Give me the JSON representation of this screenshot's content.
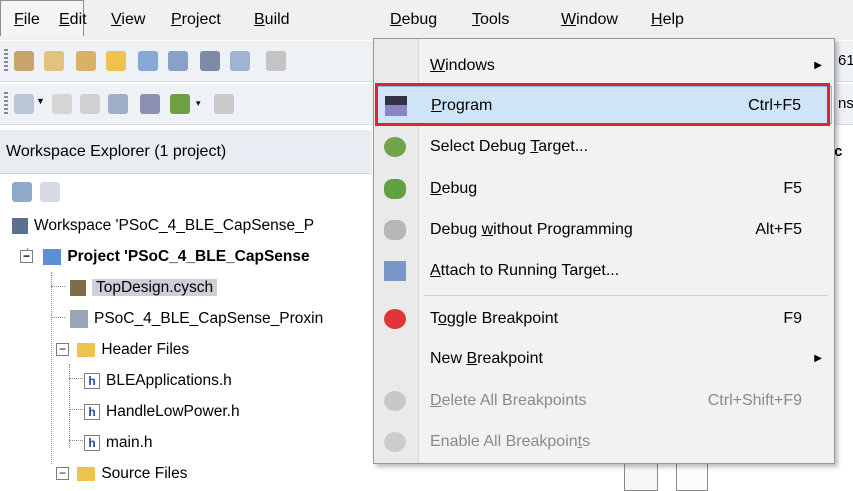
{
  "menubar": {
    "items": [
      {
        "pre": "",
        "u": "F",
        "post": "ile"
      },
      {
        "pre": "",
        "u": "E",
        "post": "dit"
      },
      {
        "pre": "",
        "u": "V",
        "post": "iew"
      },
      {
        "pre": "",
        "u": "P",
        "post": "roject"
      },
      {
        "pre": "",
        "u": "B",
        "post": "uild"
      },
      {
        "pre": "",
        "u": "D",
        "post": "ebug"
      },
      {
        "pre": "",
        "u": "T",
        "post": "ools"
      },
      {
        "pre": "",
        "u": "W",
        "post": "indow"
      },
      {
        "pre": "",
        "u": "H",
        "post": "elp"
      }
    ]
  },
  "workspace": {
    "header": "Workspace Explorer (1 project)",
    "workspace_label": "Workspace 'PSoC_4_BLE_CapSense_P",
    "project_label": "Project  'PSoC_4_BLE_CapSense",
    "topdesign": "TopDesign.cysch",
    "cydwr": "PSoC_4_BLE_CapSense_Proxin",
    "header_files": "Header Files",
    "files": [
      "BLEApplications.h",
      "HandleLowPower.h",
      "main.h"
    ],
    "source_files": "Source Files"
  },
  "right_fragments": {
    "a": "61",
    "b": "ns",
    "c": ".c"
  },
  "debug_menu": {
    "windows": {
      "pre": "",
      "u": "W",
      "post": "indows"
    },
    "program": {
      "pre": "",
      "u": "P",
      "post": "rogram",
      "shortcut": "Ctrl+F5"
    },
    "select_target": {
      "pre": "Select Debug ",
      "u": "T",
      "post": "arget..."
    },
    "debug": {
      "pre": "",
      "u": "D",
      "post": "ebug",
      "shortcut": "F5"
    },
    "debug_wo": {
      "pre": "Debug ",
      "u": "w",
      "post": "ithout Programming",
      "shortcut": "Alt+F5"
    },
    "attach": {
      "pre": "",
      "u": "A",
      "post": "ttach to Running Target..."
    },
    "toggle_bp": {
      "pre": "T",
      "u": "o",
      "post": "ggle Breakpoint",
      "shortcut": "F9"
    },
    "new_bp": {
      "pre": "New ",
      "u": "B",
      "post": "reakpoint"
    },
    "delete_bp": {
      "pre": "",
      "u": "D",
      "post": "elete All Breakpoints",
      "shortcut": "Ctrl+Shift+F9"
    },
    "enable_bp": {
      "pre": "Enable All Breakpoin",
      "u": "t",
      "post": "s"
    }
  },
  "colors": {
    "highlight": "#cfe4f7",
    "callout": "#e8202a"
  }
}
